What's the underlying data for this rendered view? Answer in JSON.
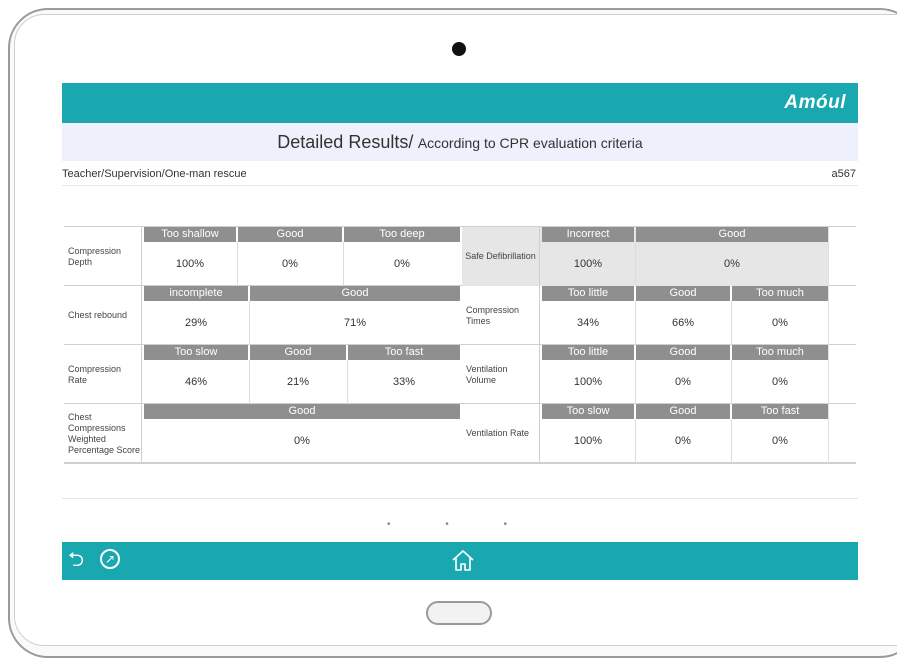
{
  "brand": "Amóul",
  "title": {
    "main": "Detailed Results/",
    "sub": "According to CPR evaluation criteria"
  },
  "info": {
    "path": "Teacher/Supervision/One-man rescue",
    "id": "a567"
  },
  "rows": [
    {
      "left": {
        "label": "Compression Depth",
        "heads": [
          "Too shallow",
          "Good",
          "Too deep"
        ],
        "values": [
          "100%",
          "0%",
          "0%"
        ]
      },
      "right": {
        "label": "Safe Defibrillation",
        "heads": [
          "Incorrect",
          "Good"
        ],
        "values": [
          "100%",
          "0%"
        ]
      }
    },
    {
      "left": {
        "label": "Chest rebound",
        "heads": [
          "incomplete",
          "Good"
        ],
        "values": [
          "29%",
          "71%"
        ]
      },
      "right": {
        "label": "Compression Times",
        "heads": [
          "Too little",
          "Good",
          "Too much"
        ],
        "values": [
          "34%",
          "66%",
          "0%"
        ]
      }
    },
    {
      "left": {
        "label": "Compression Rate",
        "heads": [
          "Too slow",
          "Good",
          "Too fast"
        ],
        "values": [
          "46%",
          "21%",
          "33%"
        ]
      },
      "right": {
        "label": "Ventilation Volume",
        "heads": [
          "Too little",
          "Good",
          "Too much"
        ],
        "values": [
          "100%",
          "0%",
          "0%"
        ]
      }
    },
    {
      "left": {
        "label": "Chest Compressions Weighted Percentage Score",
        "heads": [
          "Good"
        ],
        "values": [
          "0%"
        ]
      },
      "right": {
        "label": "Ventilation Rate",
        "heads": [
          "Too slow",
          "Good",
          "Too fast"
        ],
        "values": [
          "100%",
          "0%",
          "0%"
        ]
      }
    }
  ],
  "pager": {
    "dots": "• • •",
    "current_page": 3,
    "total_pages": 3
  },
  "nav": {
    "back_icon": "back-icon",
    "share_icon": "share-icon",
    "home_icon": "home-icon"
  },
  "colors": {
    "accent": "#1aa8b0",
    "header_gray": "#8f8f8f",
    "title_bg": "#eef0fb"
  }
}
